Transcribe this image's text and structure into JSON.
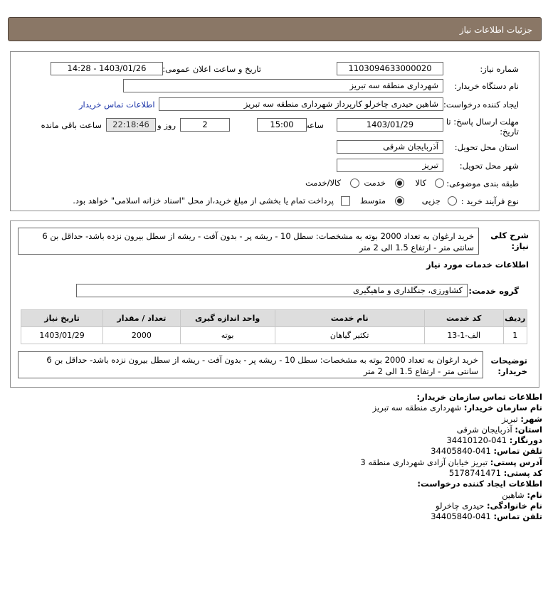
{
  "header": {
    "title": "جزئیات اطلاعات نیاز"
  },
  "form": {
    "need_number_label": "شماره نیاز:",
    "need_number": "1103094633000020",
    "announce_label": "تاریخ و ساعت اعلان عمومی:",
    "announce_value": "1403/01/26 - 14:28",
    "buyer_org_label": "نام دستگاه خریدار:",
    "buyer_org": "شهرداری منطقه سه تبریز",
    "requester_label": "ایجاد کننده درخواست:",
    "requester": "شاهین حیدری چاخرلو کارپرداز شهرداری منطقه سه تبریز",
    "contact_link": "اطلاعات تماس خریدار",
    "deadline_label_1": "مهلت ارسال پاسخ: تا",
    "deadline_label_2": "تاریخ:",
    "deadline_date": "1403/01/29",
    "time_label": "ساعت",
    "deadline_time": "15:00",
    "days_value": "2",
    "days_label": "روز و",
    "remaining_time": "22:18:46",
    "remaining_label": "ساعت باقی مانده",
    "province_label": "استان محل تحویل:",
    "province": "آذربایجان شرقی",
    "city_label": "شهر محل تحویل:",
    "city": "تبریز",
    "category_label": "طبقه بندی موضوعی:",
    "category_options": [
      "کالا",
      "خدمت",
      "کالا/خدمت"
    ],
    "category_selected": "خدمت",
    "process_label": "نوع فرآیند خرید :",
    "process_options": [
      "جزیی",
      "متوسط"
    ],
    "process_selected": "متوسط",
    "payment_note": "پرداخت تمام یا بخشی از مبلغ خرید،از محل \"اسناد خزانه اسلامی\" خواهد بود."
  },
  "summary": {
    "label_1": "شرح کلی",
    "label_2": "نیاز:",
    "text_line1": "خرید ارغوان به تعداد 2000 بوته به مشخصات: سطل 10 - ریشه پر - بدون آفت - ریشه از سطل بیرون نزده باشد- حداقل بن 6",
    "text_line2": "سانتی متر - ارتفاع 1.5 الی 2 متر"
  },
  "services": {
    "section_title": "اطلاعات خدمات مورد نیاز",
    "group_label": "گروه خدمت:",
    "group_value": "کشاورزی، جنگلداری و ماهیگیری",
    "table": {
      "headers": [
        "ردیف",
        "کد خدمت",
        "نام خدمت",
        "واحد اندازه گیری",
        "تعداد / مقدار",
        "تاریخ نیاز"
      ],
      "rows": [
        [
          "1",
          "الف-1-13",
          "تکثیر گیاهان",
          "بوته",
          "2000",
          "1403/01/29"
        ]
      ]
    },
    "buyer_desc_label_1": "توضیحات",
    "buyer_desc_label_2": "خریدار:",
    "buyer_desc_line1": "خرید ارغوان به تعداد 2000 بوته به مشخصات: سطل 10 - ریشه پر - بدون آفت - ریشه از سطل بیرون نزده باشد- حداقل بن 6",
    "buyer_desc_line2": "سانتی متر - ارتفاع 1.5 الی 2 متر"
  },
  "contact": {
    "title": "اطلاعات تماس سازمان خریدار:",
    "org_label": "نام سازمان خریدار:",
    "org": "شهرداری منطقه سه تبریز",
    "city_label": "شهر:",
    "city": "تبریز",
    "province_label": "استان:",
    "province": "آذربایجان شرقی",
    "fax_label": "دورنگار:",
    "fax": "041-34410120",
    "phone_label": "تلفن تماس:",
    "phone": "041-34405840",
    "address_label": "آدرس پستی:",
    "address": "تبریز خیابان آزادی شهرداری منطقه 3",
    "postal_label": "کد پستی:",
    "postal": "5178741471",
    "creator_title": "اطلاعات ایجاد کننده درخواست:",
    "name_label": "نام:",
    "name": "شاهین",
    "family_label": "نام خانوادگی:",
    "family": "حیدری چاخرلو",
    "creator_phone_label": "تلفن تماس:",
    "creator_phone": "041-34405840"
  }
}
